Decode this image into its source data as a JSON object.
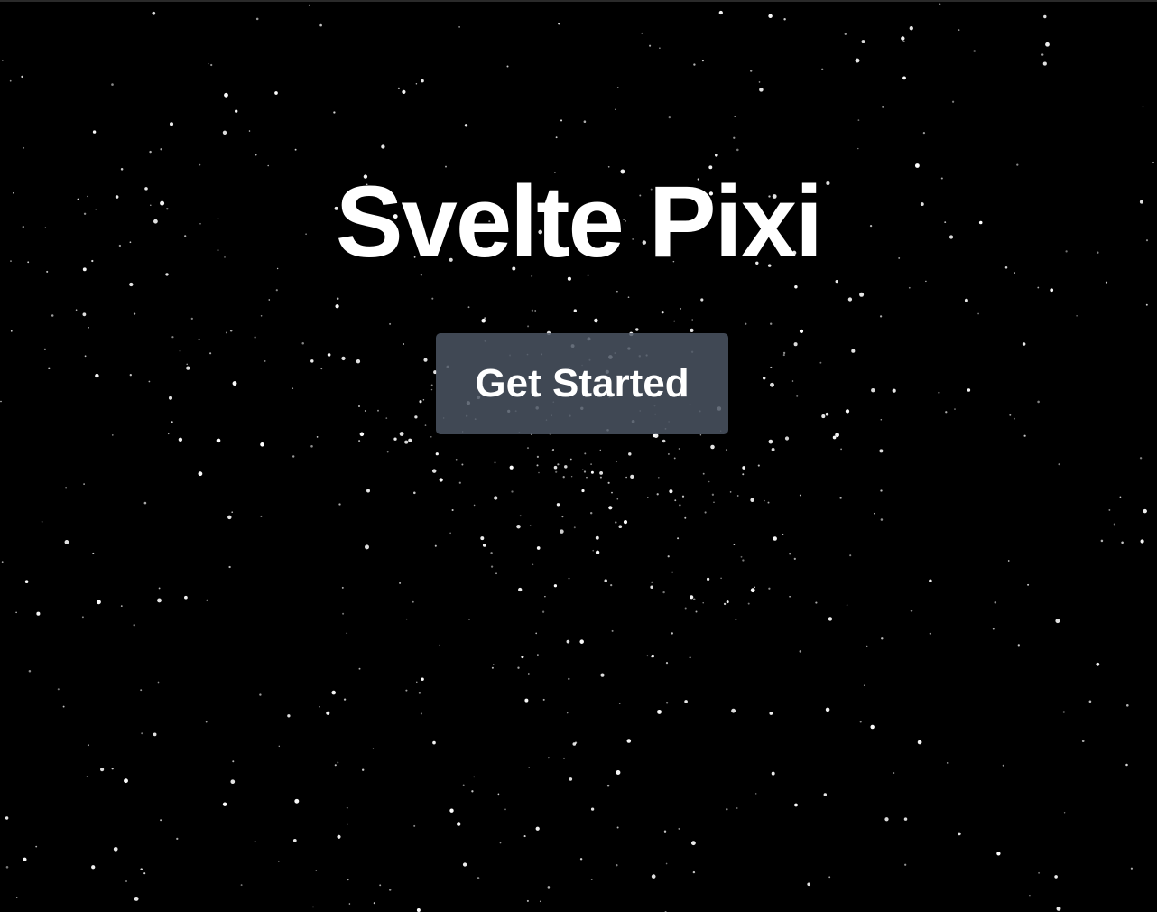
{
  "hero": {
    "title": "Svelte Pixi",
    "cta_label": "Get Started"
  },
  "theme": {
    "background": "#000000",
    "star_color": "#ffffff",
    "button_bg": "#4b5563",
    "text_color": "#ffffff"
  }
}
